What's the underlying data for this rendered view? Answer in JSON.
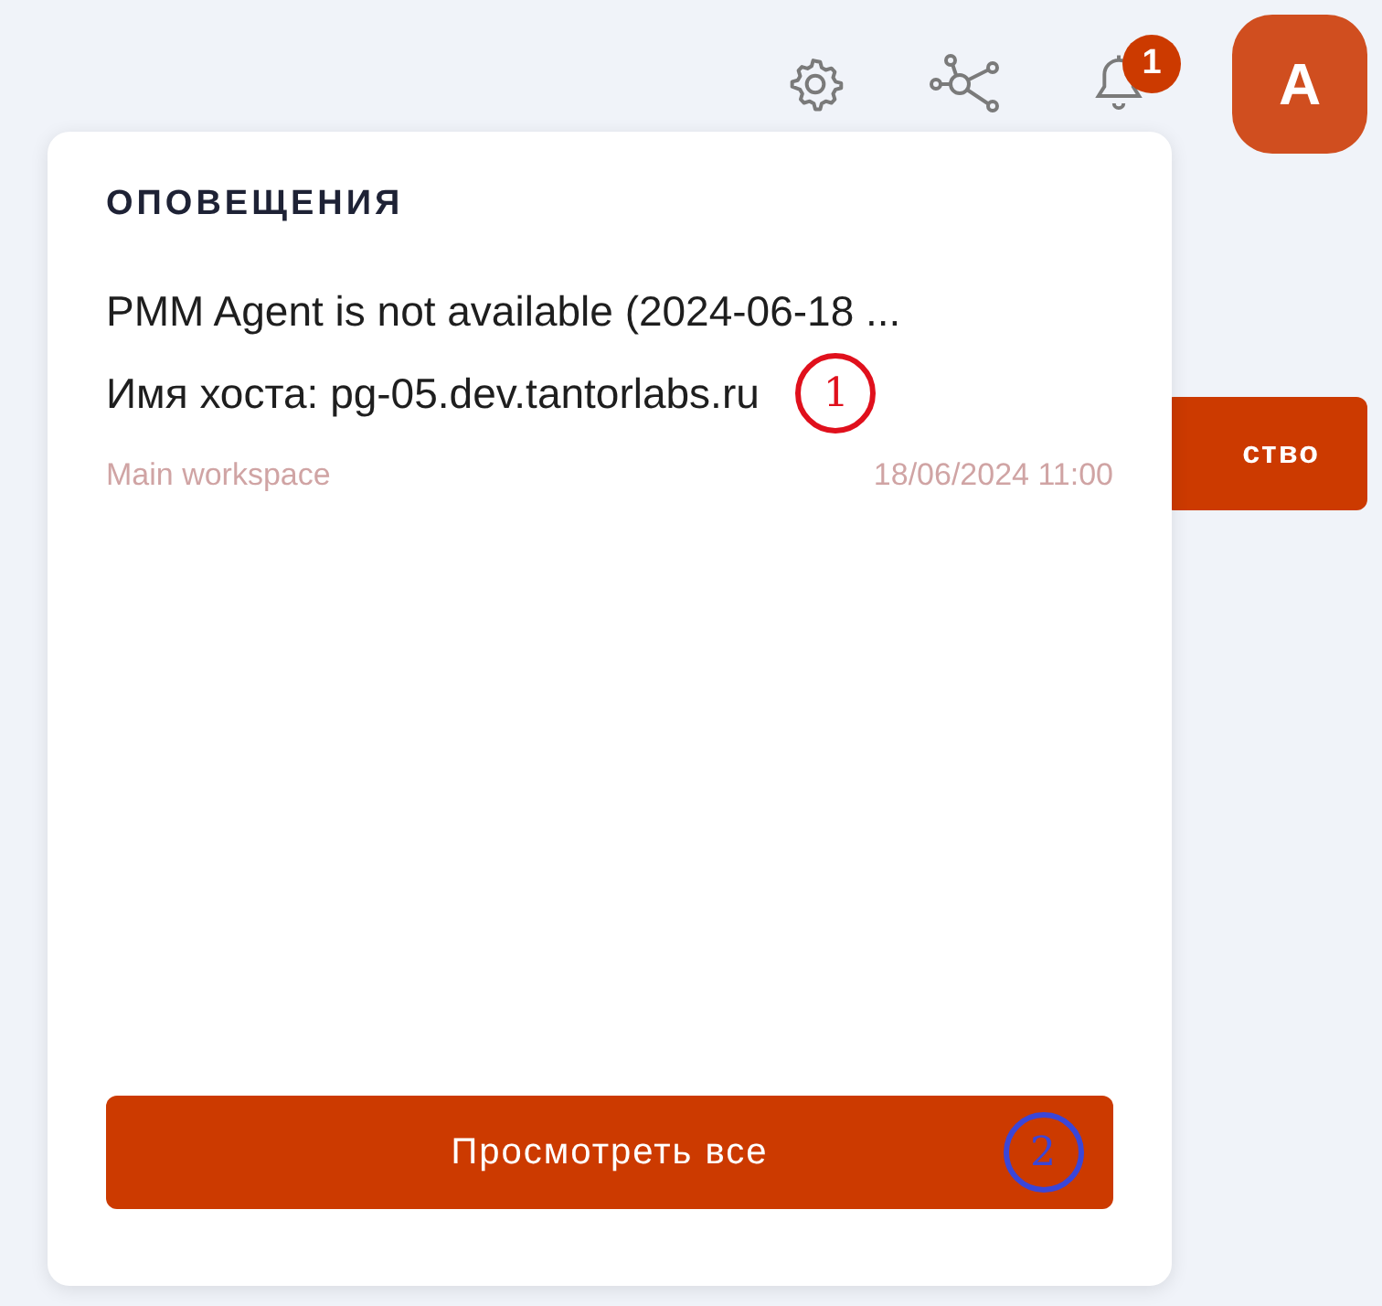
{
  "header": {
    "notification_count": "1",
    "avatar": "A"
  },
  "background_button": {
    "label": "ство"
  },
  "notifications_panel": {
    "title": "ОПОВЕЩЕНИЯ",
    "items": [
      {
        "title": "PMM Agent is not available (2024-06-18 ...",
        "host": "Имя хоста: pg-05.dev.tantorlabs.ru",
        "workspace": "Main workspace",
        "time": "18/06/2024 11:00"
      }
    ],
    "view_all_button": "Просмотреть все"
  },
  "annotations": [
    {
      "label": "1",
      "color": "#e0101c"
    },
    {
      "label": "2",
      "color": "#3a46d8"
    }
  ]
}
